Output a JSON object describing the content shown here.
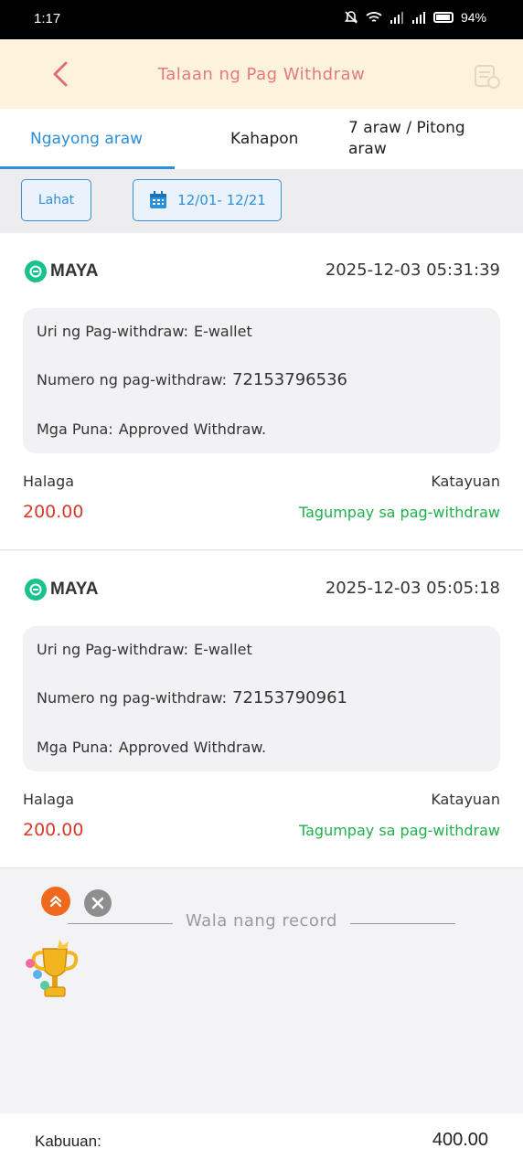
{
  "status_bar": {
    "time": "1:17",
    "battery": "94%"
  },
  "header": {
    "title": "Talaan ng Pag Withdraw"
  },
  "tabs": [
    {
      "label": "Ngayong araw",
      "active": true
    },
    {
      "label": "Kahapon",
      "active": false
    },
    {
      "label_line1": "7 araw / Pitong",
      "label_line2": "araw",
      "active": false
    }
  ],
  "filters": {
    "all_label": "Lahat",
    "date_range": "12/01- 12/21"
  },
  "records": [
    {
      "provider": "MAYA",
      "datetime": "2025-12-03 05:31:39",
      "type_label": "Uri ng Pag-withdraw:",
      "type_value": "E-wallet",
      "number_label": "Numero ng pag-withdraw:",
      "number_value": "72153796536",
      "remarks_label": "Mga Puna:",
      "remarks_value": "Approved Withdraw.",
      "amount_label": "Halaga",
      "amount": "200.00",
      "status_label": "Katayuan",
      "status": "Tagumpay sa pag-withdraw"
    },
    {
      "provider": "MAYA",
      "datetime": "2025-12-03 05:05:18",
      "type_label": "Uri ng Pag-withdraw:",
      "type_value": "E-wallet",
      "number_label": "Numero ng pag-withdraw:",
      "number_value": "72153790961",
      "remarks_label": "Mga Puna:",
      "remarks_value": "Approved Withdraw.",
      "amount_label": "Halaga",
      "amount": "200.00",
      "status_label": "Katayuan",
      "status": "Tagumpay sa pag-withdraw"
    }
  ],
  "empty_text": "Wala nang record",
  "footer": {
    "total_label": "Kabuuan:",
    "total_value": "400.00"
  },
  "colors": {
    "accent": "#2c8fd8",
    "amount": "#d53a2a",
    "success": "#1fb04b",
    "header_bg": "#fdf3dd",
    "header_title": "#e57a7a",
    "maya": "#17c28b"
  },
  "icons": [
    "back-arrow-icon",
    "receipt-icon",
    "calendar-icon",
    "maya-logo-icon",
    "scroll-top-icon",
    "close-icon",
    "trophy-icon",
    "wifi-icon",
    "signal-icon",
    "battery-icon",
    "mute-icon"
  ]
}
